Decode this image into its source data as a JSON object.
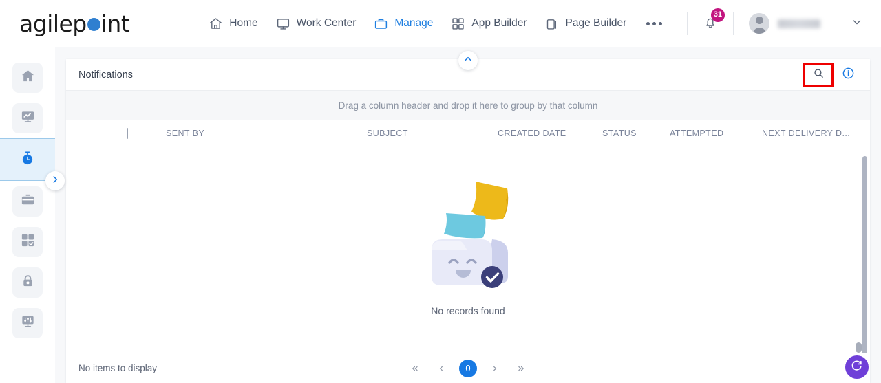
{
  "brand": {
    "name_part1": "agilep",
    "name_part2": "int",
    "accent": "#2f7fd0"
  },
  "header": {
    "nav": [
      {
        "label": "Home",
        "icon": "home-icon",
        "active": false
      },
      {
        "label": "Work Center",
        "icon": "monitor-icon",
        "active": false
      },
      {
        "label": "Manage",
        "icon": "briefcase-icon",
        "active": true
      },
      {
        "label": "App Builder",
        "icon": "grid-icon",
        "active": false
      },
      {
        "label": "Page Builder",
        "icon": "pages-icon",
        "active": false
      }
    ],
    "more_label": "More options",
    "notifications_count": "31",
    "notification_badge_color": "#c2157f",
    "user_name": "",
    "user_chevron": "chevron-down-icon"
  },
  "sidebar": {
    "items": [
      {
        "name": "home",
        "icon": "home-icon",
        "active": false
      },
      {
        "name": "analytics",
        "icon": "monitor-chart-icon",
        "active": false
      },
      {
        "name": "activities",
        "icon": "stopwatch-icon",
        "active": true
      },
      {
        "name": "work",
        "icon": "briefcase-icon",
        "active": false
      },
      {
        "name": "apps",
        "icon": "grid-check-icon",
        "active": false
      },
      {
        "name": "access",
        "icon": "lock-icon",
        "active": false
      },
      {
        "name": "settings",
        "icon": "sliders-icon",
        "active": false
      }
    ],
    "expand_icon": "chevron-right-icon"
  },
  "panel": {
    "title": "Notifications",
    "search_icon": "search-icon",
    "info_icon": "info-icon",
    "collapse_icon": "chevron-up-icon",
    "highlight_color": "#ee0000",
    "group_hint": "Drag a column header and drop it here to group by that column",
    "columns": [
      "SENT BY",
      "SUBJECT",
      "CREATED DATE",
      "STATUS",
      "ATTEMPTED",
      "NEXT DELIVERY D..."
    ],
    "rows": [],
    "empty_state_text": "No records found",
    "footer_label": "No items to display",
    "pagination": {
      "first": "«",
      "prev": "‹",
      "current": "0",
      "next": "›",
      "last": "»",
      "active_color": "#1779e3"
    },
    "refresh_icon": "refresh-icon",
    "refresh_color": "#6f3fd8"
  }
}
